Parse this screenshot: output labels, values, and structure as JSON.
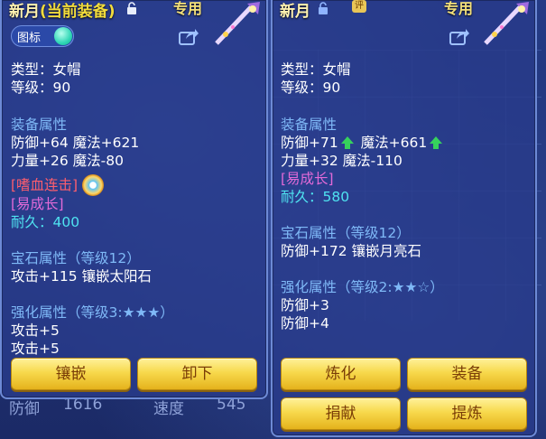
{
  "left": {
    "title": "新月",
    "current_tag": "(当前装备)",
    "dedicated": "专用",
    "toggle_label": "图标",
    "type_line": "类型：女帽",
    "level_line": "等级：90",
    "equip_header": "装备属性",
    "attr1": "防御+64 魔法+621",
    "attr2": "力量+26 魔法-80",
    "special_skill": "[嗜血连击]",
    "special_tag": "[易成长]",
    "durability": "耐久：400",
    "gem_header": "宝石属性（等级12）",
    "gem_attr": "攻击+115 镶嵌太阳石",
    "enh_header": "强化属性（等级3:★★★）",
    "enh1": "攻击+5",
    "enh2": "攻击+5",
    "btn_inlay": "镶嵌",
    "btn_unequip": "卸下"
  },
  "right": {
    "title": "新月",
    "dedicated": "专用",
    "badge": "评",
    "type_line": "类型：女帽",
    "level_line": "等级：90",
    "equip_header": "装备属性",
    "attr1a": "防御+71",
    "attr1b": "魔法+661",
    "attr2": "力量+32 魔法-110",
    "special_tag": "[易成长]",
    "durability": "耐久：580",
    "gem_header": "宝石属性（等级12）",
    "gem_attr": "防御+172 镶嵌月亮石",
    "enh_header": "强化属性（等级2:★★☆）",
    "enh1": "防御+3",
    "enh2": "防御+4",
    "btn_refine": "炼化",
    "btn_equip": "装备",
    "btn_donate": "捐献",
    "btn_extract": "提炼"
  },
  "background": {
    "stat_label1": "防御",
    "stat_value1": "1616",
    "stat_label2": "速度",
    "stat_value2": "545"
  },
  "colors": {
    "title": "#fff3b0",
    "header": "#7fb9f7",
    "button_text": "#7a3d07",
    "special_red": "#ff5e6d",
    "grow_pink": "#e26ad8",
    "durability_cyan": "#4fe3f0"
  },
  "icons": [
    "lock-icon",
    "weapon-icon",
    "share-icon",
    "swirl-icon",
    "up-arrow-icon"
  ]
}
